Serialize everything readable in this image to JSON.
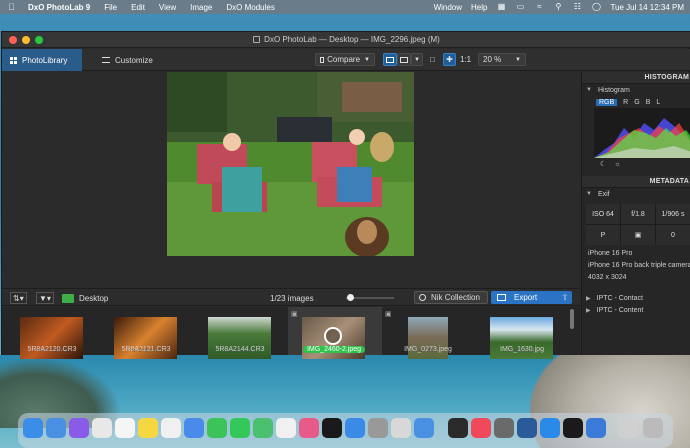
{
  "menubar": {
    "app_name": "DxO PhotoLab 9",
    "items": [
      "File",
      "Edit",
      "View",
      "Image",
      "DxO Modules"
    ],
    "right_items": [
      "Window",
      "Help"
    ],
    "datetime": "Tue Jul 14  12:34 PM"
  },
  "window": {
    "title": "DxO PhotoLab — Desktop — IMG_2296.jpeg (M)"
  },
  "toolbar": {
    "tab_photolibrary": "PhotoLibrary",
    "tab_customize": "Customize",
    "compare_label": "Compare",
    "ratio_label": "1:1",
    "zoom_value": "20 %"
  },
  "right_panel": {
    "histogram_header": "HISTOGRAM",
    "histogram_label": "Histogram",
    "channels": [
      "RGB",
      "R",
      "G",
      "B",
      "L"
    ],
    "metadata_header": "METADATA",
    "exif_label": "Exif",
    "exif_cells": [
      "ISO 64",
      "f/1.8",
      "1/906 s",
      "P",
      "",
      "0"
    ],
    "camera": "iPhone 16 Pro",
    "lens": "iPhone 16 Pro back triple camera 6.",
    "dimensions": "4032 x 3024",
    "iptc_contact": "IPTC - Contact",
    "iptc_content": "IPTC - Content"
  },
  "filmstrip_bar": {
    "folder_label": "Desktop",
    "count": "1/23 images",
    "nik_label": "Nik Collection",
    "export_label": "Export"
  },
  "thumbnails": [
    {
      "name": "5R8A2120.CR3",
      "stars": "★★★★★"
    },
    {
      "name": "5R8A2121.CR3",
      "stars": "★★★★★"
    },
    {
      "name": "5R8A2144.CR3",
      "stars": "★★★★★"
    },
    {
      "name": "IMG_2460-2.jpeg",
      "stars": "★★★★★"
    },
    {
      "name": "IMG_0273.jpeg",
      "stars": "★★★★★"
    },
    {
      "name": "IMG_1630.jpg",
      "stars": "★★★★★"
    }
  ],
  "colors": {
    "accent": "#2a73c5",
    "selected_label": "#2fc24a",
    "window_bg": "#2b2b2b"
  }
}
